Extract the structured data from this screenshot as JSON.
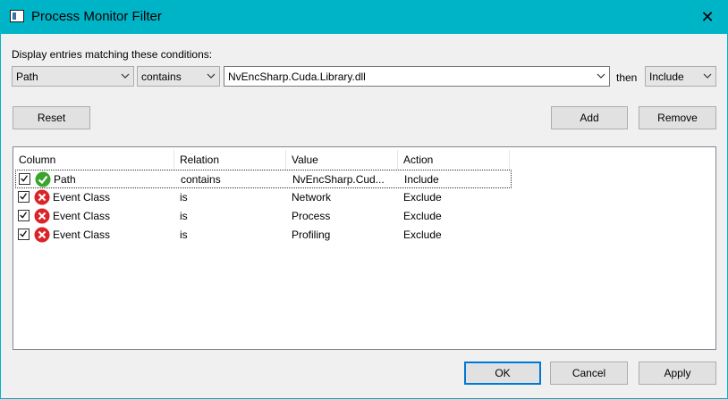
{
  "window": {
    "title": "Process Monitor Filter"
  },
  "prompt": "Display entries matching these conditions:",
  "filter": {
    "column": "Path",
    "relation": "contains",
    "value": "NvEncSharp.Cuda.Library.dll",
    "then_label": "then",
    "action": "Include"
  },
  "buttons": {
    "reset": "Reset",
    "add": "Add",
    "remove": "Remove",
    "ok": "OK",
    "cancel": "Cancel",
    "apply": "Apply"
  },
  "table": {
    "headers": [
      "Column",
      "Relation",
      "Value",
      "Action"
    ],
    "rows": [
      {
        "column": "Path",
        "relation": "contains",
        "value": "NvEncSharp.Cud...",
        "action": "Include",
        "status": "include-icon"
      },
      {
        "column": "Event Class",
        "relation": "is",
        "value": "Network",
        "action": "Exclude",
        "status": "exclude-icon"
      },
      {
        "column": "Event Class",
        "relation": "is",
        "value": "Process",
        "action": "Exclude",
        "status": "exclude-icon"
      },
      {
        "column": "Event Class",
        "relation": "is",
        "value": "Profiling",
        "action": "Exclude",
        "status": "exclude-icon"
      }
    ]
  },
  "colors": {
    "titlebar": "#00b4c8",
    "include": "#3aa52a",
    "exclude": "#d9252a",
    "accent": "#0078d7"
  }
}
